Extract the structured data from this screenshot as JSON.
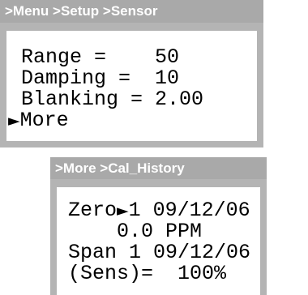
{
  "sensor_panel": {
    "breadcrumb": ">Menu >Setup >Sensor",
    "lines": {
      "range": "Range =    50",
      "damping": "Damping =  10",
      "blanking": "Blanking = 2.00",
      "more_marker": "►",
      "more": "More"
    }
  },
  "history_panel": {
    "breadcrumb": ">More >Cal_History",
    "lines": {
      "zero_label": "Zero",
      "zero_marker": "►",
      "zero_value": "1 09/12/06",
      "zero_reading": "    0.0 PPM",
      "span": "Span 1 09/12/06",
      "sens": "(Sens)=  100%"
    }
  }
}
